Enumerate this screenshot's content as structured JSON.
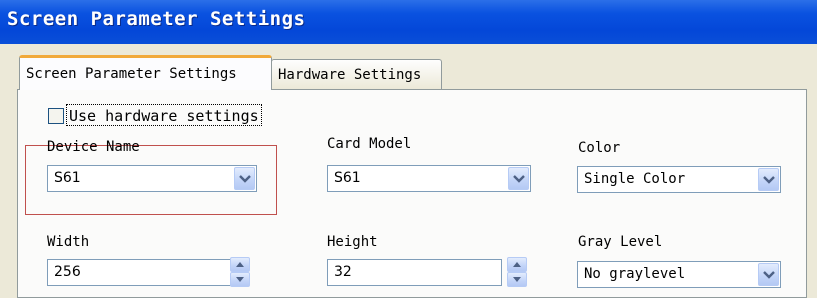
{
  "window": {
    "title": "Screen Parameter Settings"
  },
  "tabs": [
    {
      "label": "Screen Parameter Settings",
      "active": true
    },
    {
      "label": "Hardware Settings",
      "active": false
    }
  ],
  "use_hardware": {
    "label": "Use hardware settings",
    "checked": false
  },
  "device_name": {
    "label": "Device Name",
    "value": "S61"
  },
  "card_model": {
    "label": "Card Model",
    "value": "S61"
  },
  "color": {
    "label": "Color",
    "value": "Single Color"
  },
  "width": {
    "label": "Width",
    "value": "256"
  },
  "height": {
    "label": "Height",
    "value": "32"
  },
  "gray_level": {
    "label": "Gray Level",
    "value": "No graylevel"
  },
  "icons": {
    "dropdown": "chevron-down-icon",
    "spin_up": "arrow-up-icon",
    "spin_down": "arrow-down-icon"
  },
  "colors": {
    "titlebar": "#0a52e0",
    "active_tab_accent": "#f1a93a",
    "highlight_box": "#c0504d"
  }
}
